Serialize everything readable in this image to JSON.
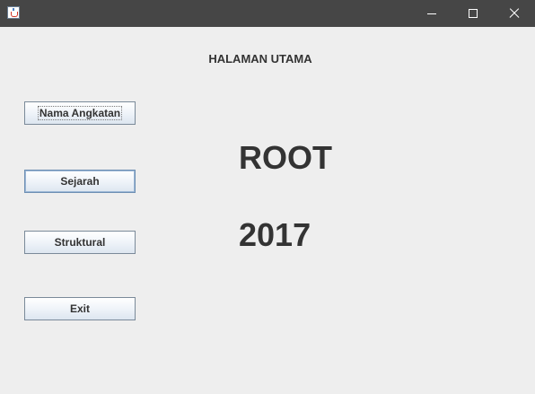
{
  "window": {
    "minimize_glyph": "minimize-icon",
    "maximize_glyph": "maximize-icon",
    "close_glyph": "close-icon"
  },
  "main": {
    "heading": "HALAMAN UTAMA",
    "root_label": "ROOT",
    "year_label": "2017"
  },
  "buttons": [
    {
      "label": "Nama Angkatan"
    },
    {
      "label": "Sejarah"
    },
    {
      "label": "Struktural"
    },
    {
      "label": "Exit"
    }
  ],
  "colors": {
    "titlebar": "#464646",
    "background": "#eeeeee",
    "text": "#333333"
  }
}
